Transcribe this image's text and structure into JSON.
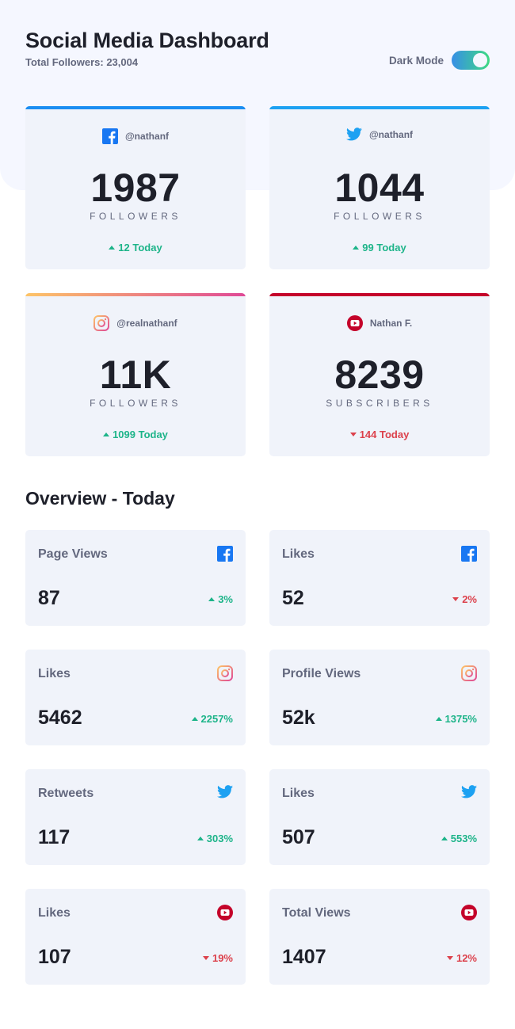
{
  "header": {
    "title": "Social Media Dashboard",
    "total_followers": "Total Followers: 23,004",
    "dark_mode_label": "Dark Mode",
    "toggle_on": true
  },
  "colors": {
    "facebook": "#1877f2",
    "twitter": "#1da1f2",
    "instagram_start": "#fdc468",
    "instagram_end": "#df4996",
    "youtube": "#c4032a",
    "up": "#1db489",
    "down": "#dc414c"
  },
  "followers": [
    {
      "network": "facebook",
      "icon": "facebook-icon",
      "handle": "@nathanf",
      "count": "1987",
      "caption": "FOLLOWERS",
      "change": "12 Today",
      "direction": "up"
    },
    {
      "network": "twitter",
      "icon": "twitter-icon",
      "handle": "@nathanf",
      "count": "1044",
      "caption": "FOLLOWERS",
      "change": "99 Today",
      "direction": "up"
    },
    {
      "network": "instagram",
      "icon": "instagram-icon",
      "handle": "@realnathanf",
      "count": "11K",
      "caption": "FOLLOWERS",
      "change": "1099 Today",
      "direction": "up"
    },
    {
      "network": "youtube",
      "icon": "youtube-icon",
      "handle": "Nathan F.",
      "count": "8239",
      "caption": "SUBSCRIBERS",
      "change": "144 Today",
      "direction": "down"
    }
  ],
  "overview": {
    "title": "Overview - Today",
    "items": [
      {
        "label": "Page Views",
        "network": "facebook",
        "icon": "facebook-icon",
        "value": "87",
        "change": "3%",
        "direction": "up"
      },
      {
        "label": "Likes",
        "network": "facebook",
        "icon": "facebook-icon",
        "value": "52",
        "change": "2%",
        "direction": "down"
      },
      {
        "label": "Likes",
        "network": "instagram",
        "icon": "instagram-icon",
        "value": "5462",
        "change": "2257%",
        "direction": "up"
      },
      {
        "label": "Profile Views",
        "network": "instagram",
        "icon": "instagram-icon",
        "value": "52k",
        "change": "1375%",
        "direction": "up"
      },
      {
        "label": "Retweets",
        "network": "twitter",
        "icon": "twitter-icon",
        "value": "117",
        "change": "303%",
        "direction": "up"
      },
      {
        "label": "Likes",
        "network": "twitter",
        "icon": "twitter-icon",
        "value": "507",
        "change": "553%",
        "direction": "up"
      },
      {
        "label": "Likes",
        "network": "youtube",
        "icon": "youtube-icon",
        "value": "107",
        "change": "19%",
        "direction": "down"
      },
      {
        "label": "Total Views",
        "network": "youtube",
        "icon": "youtube-icon",
        "value": "1407",
        "change": "12%",
        "direction": "down"
      }
    ]
  }
}
